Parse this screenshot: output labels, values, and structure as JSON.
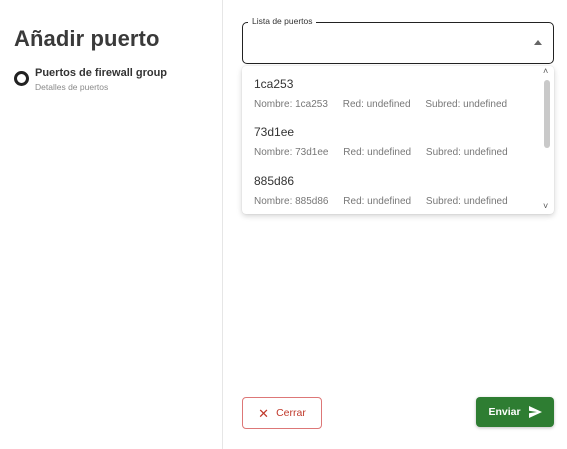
{
  "page": {
    "title": "Añadir puerto"
  },
  "stepper": {
    "step_title": "Puertos de firewall group",
    "step_subtitle": "Detalles de puertos"
  },
  "form": {
    "ports_label": "Lista de puertos",
    "options": [
      {
        "name": "1ca253",
        "nombre": "Nombre: 1ca253",
        "red": "Red: undefined",
        "subred": "Subred: undefined"
      },
      {
        "name": "73d1ee",
        "nombre": "Nombre: 73d1ee",
        "red": "Red: undefined",
        "subred": "Subred: undefined"
      },
      {
        "name": "885d86",
        "nombre": "Nombre: 885d86",
        "red": "Red: undefined",
        "subred": "Subred: undefined"
      }
    ]
  },
  "footer": {
    "cancel_label": "Cerrar",
    "submit_label": "Enviar"
  },
  "icons": {
    "close": "close-icon",
    "send": "send-icon",
    "dropdown_arrow": "chevron-up-icon"
  },
  "colors": {
    "submit_bg": "#2e7d32",
    "cancel_text": "#c0392b",
    "cancel_border": "#dd7777"
  }
}
